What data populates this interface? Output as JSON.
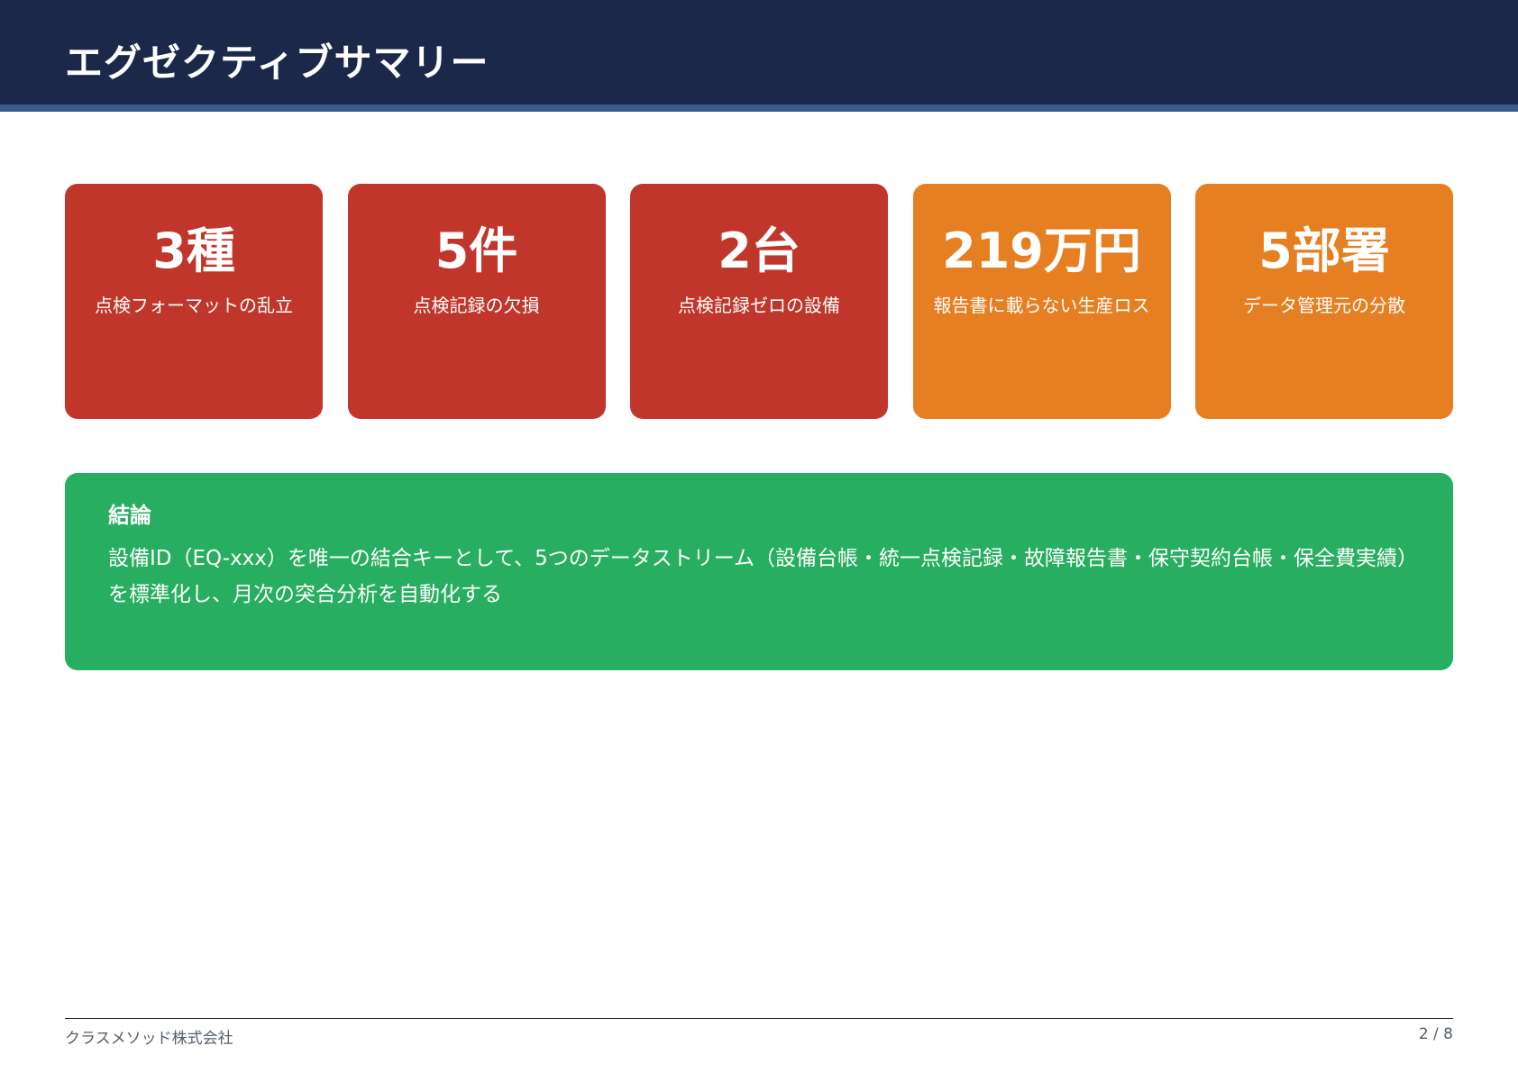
{
  "header": {
    "title": "エグゼクティブサマリー"
  },
  "kpis": [
    {
      "value": "3種",
      "label": "点検フォーマットの乱立",
      "color": "#c0362b"
    },
    {
      "value": "5件",
      "label": "点検記録の欠損",
      "color": "#c0362b"
    },
    {
      "value": "2台",
      "label": "点検記録ゼロの設備",
      "color": "#c0362b"
    },
    {
      "value": "219万円",
      "label": "報告書に載らない生産ロス",
      "color": "#e67e22"
    },
    {
      "value": "5部署",
      "label": "データ管理元の分散",
      "color": "#e67e22"
    }
  ],
  "conclusion": {
    "heading": "結論",
    "text": "設備ID（EQ-xxx）を唯一の結合キーとして、5つのデータストリーム（設備台帳・統一点検記録・故障報告書・保守契約台帳・保全費実績）を標準化し、月次の突合分析を自動化する",
    "color": "#27ae60"
  },
  "footer": {
    "company": "クラスメソッド株式会社",
    "page": "2 / 8"
  },
  "colors": {
    "header_bg": "#1b2849",
    "header_accent": "#3a5a8c",
    "alert_red": "#c0362b",
    "warning_orange": "#e67e22",
    "success_green": "#27ae60"
  }
}
